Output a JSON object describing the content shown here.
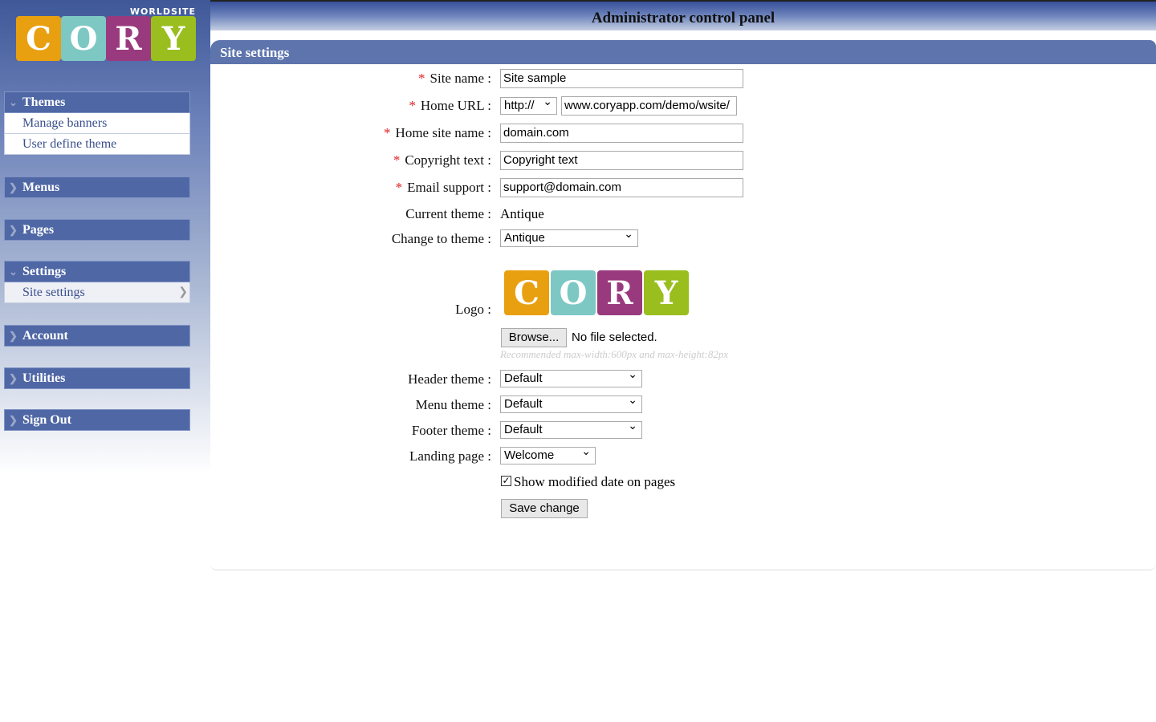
{
  "logo": {
    "brand": "WORLDSITE",
    "letters": [
      "C",
      "O",
      "R",
      "Y"
    ],
    "colors": [
      "#e8a010",
      "#7ec8c4",
      "#9a3a7e",
      "#9abe1e"
    ]
  },
  "sidebar": {
    "groups": [
      {
        "label": "Themes",
        "expanded": true,
        "items": [
          "Manage banners",
          "User define theme"
        ]
      },
      {
        "label": "Menus",
        "expanded": false,
        "items": []
      },
      {
        "label": "Pages",
        "expanded": false,
        "items": []
      },
      {
        "label": "Settings",
        "expanded": true,
        "items": [
          "Site settings"
        ],
        "active": "Site settings"
      },
      {
        "label": "Account",
        "expanded": false,
        "items": []
      },
      {
        "label": "Utilities",
        "expanded": false,
        "items": []
      },
      {
        "label": "Sign Out",
        "expanded": false,
        "items": []
      }
    ]
  },
  "header": {
    "title": "Administrator control panel"
  },
  "panel": {
    "title": "Site settings"
  },
  "form": {
    "site_name": {
      "label": "Site name :",
      "value": "Site sample"
    },
    "home_url": {
      "label": "Home URL :",
      "protocol": "http://",
      "value": "www.coryapp.com/demo/wsite/"
    },
    "home_site_name": {
      "label": "Home site name :",
      "value": "domain.com"
    },
    "copyright": {
      "label": "Copyright text :",
      "value": "Copyright text"
    },
    "email": {
      "label": "Email support :",
      "value": "support@domain.com"
    },
    "current_theme": {
      "label": "Current theme :",
      "value": "Antique"
    },
    "change_theme": {
      "label": "Change to theme :",
      "value": "Antique"
    },
    "logo": {
      "label": "Logo :",
      "browse": "Browse...",
      "file_status": "No file selected.",
      "hint": "Recommended max-width:600px and max-height:82px"
    },
    "header_theme": {
      "label": "Header theme :",
      "value": "Default"
    },
    "menu_theme": {
      "label": "Menu theme :",
      "value": "Default"
    },
    "footer_theme": {
      "label": "Footer theme :",
      "value": "Default"
    },
    "landing_page": {
      "label": "Landing page :",
      "value": "Welcome"
    },
    "show_modified": {
      "label": "Show modified date on pages",
      "checked": true
    },
    "save": "Save change",
    "required_mark": "*"
  }
}
